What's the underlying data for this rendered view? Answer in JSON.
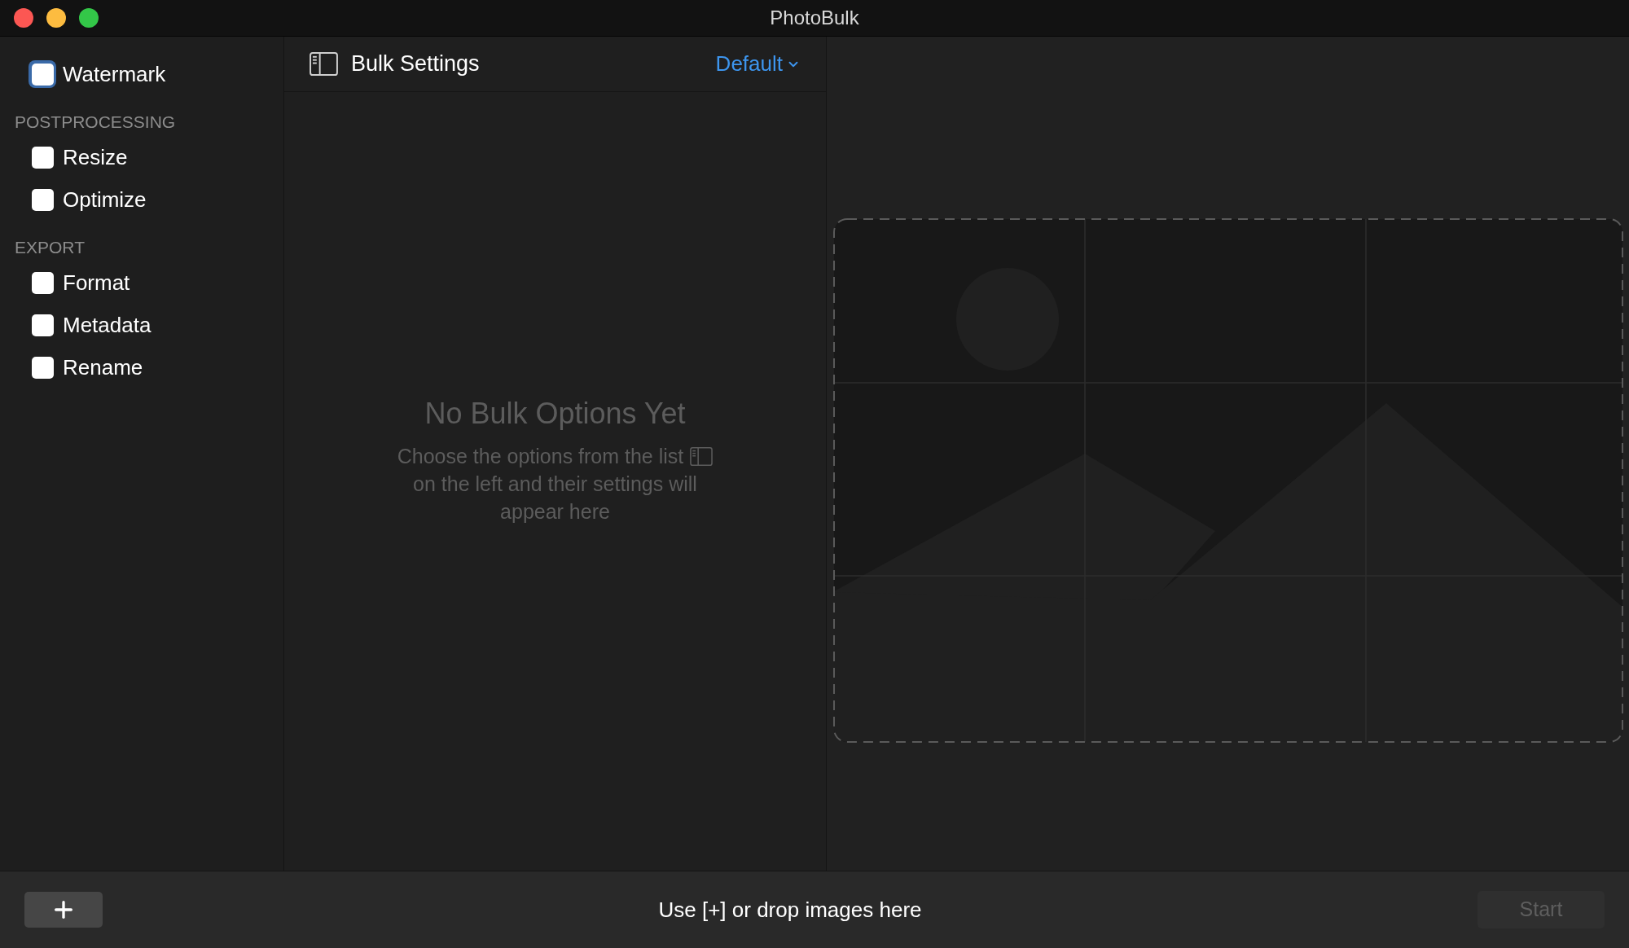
{
  "window": {
    "title": "PhotoBulk"
  },
  "sidebar": {
    "top_items": [
      {
        "label": "Watermark",
        "checked": false,
        "focused": true
      }
    ],
    "sections": [
      {
        "heading": "POSTPROCESSING",
        "items": [
          {
            "label": "Resize",
            "checked": false,
            "focused": false
          },
          {
            "label": "Optimize",
            "checked": false,
            "focused": false
          }
        ]
      },
      {
        "heading": "EXPORT",
        "items": [
          {
            "label": "Format",
            "checked": false,
            "focused": false
          },
          {
            "label": "Metadata",
            "checked": false,
            "focused": false
          },
          {
            "label": "Rename",
            "checked": false,
            "focused": false
          }
        ]
      }
    ]
  },
  "settings_panel": {
    "title": "Bulk Settings",
    "preset": "Default",
    "empty_title": "No Bulk Options Yet",
    "empty_text_lines": [
      "Choose the options from the list",
      "on the left and their settings will",
      "appear here"
    ]
  },
  "bottom_bar": {
    "hint": "Use [+] or drop images here",
    "start_button": {
      "label": "Start",
      "disabled": true
    }
  }
}
